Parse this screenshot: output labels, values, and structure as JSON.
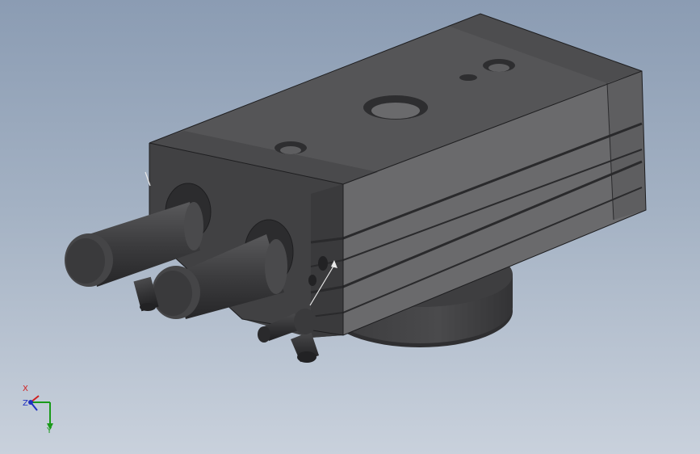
{
  "viewport": {
    "background_top": "#8b9cb3",
    "background_bottom": "#c9d1dc"
  },
  "model": {
    "icon": "rotary-gripper-3d-model",
    "colors": {
      "top_face": "#555557",
      "side_face": "#3f3f41",
      "front_face": "#6a6a6c",
      "dark": "#2b2b2d"
    }
  },
  "triad": {
    "x_label": "X",
    "y_label": "Y",
    "z_label": "Z",
    "colors": {
      "x": "#d02020",
      "y": "#1a9a1a",
      "z": "#2030c0"
    }
  }
}
